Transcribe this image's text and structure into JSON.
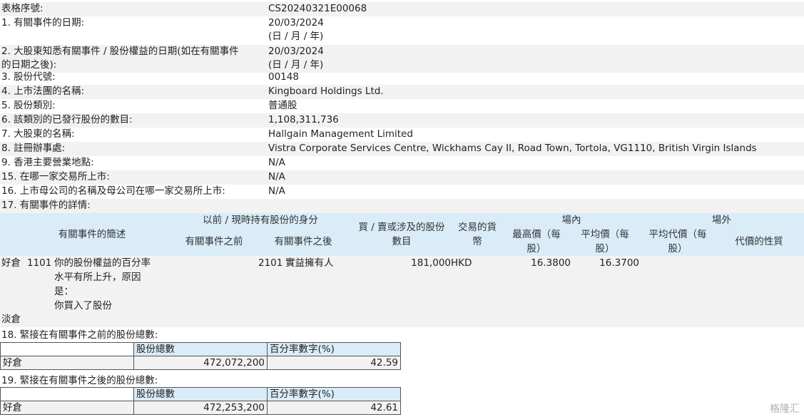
{
  "form_serial": {
    "label": "表格序號:",
    "value": "CS20240321E00068"
  },
  "fields": [
    {
      "label": [
        "1. 有關事件的日期:"
      ],
      "value": [
        "20/03/2024",
        "(日 / 月 / 年)"
      ]
    },
    {
      "label": [
        "2. 大股東知悉有關事件 / 股份權益的日期(如在有關事件",
        "的日期之後):"
      ],
      "value": [
        "20/03/2024",
        "(日 / 月 / 年)"
      ]
    },
    {
      "label": [
        "3. 股份代號:"
      ],
      "value": [
        "00148"
      ]
    },
    {
      "label": [
        "4. 上市法團的名稱:"
      ],
      "value": [
        "Kingboard Holdings Ltd."
      ]
    },
    {
      "label": [
        "5. 股份類別:"
      ],
      "value": [
        "普通股"
      ]
    },
    {
      "label": [
        "6. 該類別的已發行股份的數目:"
      ],
      "value": [
        "1,108,311,736"
      ]
    },
    {
      "label": [
        "7. 大股東的名稱:"
      ],
      "value": [
        "Hallgain Management Limited"
      ]
    },
    {
      "label": [
        "8. 註冊辦事處:"
      ],
      "value": [
        "Vistra Corporate Services Centre, Wickhams Cay II, Road Town, Tortola, VG1110, British Virgin Islands"
      ]
    },
    {
      "label": [
        "9. 香港主要營業地點:"
      ],
      "value": [
        "N/A"
      ]
    },
    {
      "label": [
        "15. 在哪一家交易所上市:"
      ],
      "value": [
        "N/A"
      ]
    },
    {
      "label": [
        "16. 上市母公司的名稱及母公司在哪一家交易所上市:"
      ],
      "value": [
        "N/A"
      ]
    }
  ],
  "section17": {
    "title": "17. 有關事件的詳情:",
    "headers": {
      "brief": "有關事件的簡述",
      "capacity": "以前 / 現時持有股份的身分",
      "before": "有關事件之前",
      "after": "有關事件之後",
      "shares": [
        "買 / 賣或涉及的股份",
        "數目"
      ],
      "currency": [
        "交易的貨",
        "幣"
      ],
      "onexchange": "場內",
      "high": [
        "最高價（每",
        "股）"
      ],
      "avg": [
        "平均價（每",
        "股）"
      ],
      "offexchange": "場外",
      "off_avg": [
        "平均代價（每",
        "股）"
      ],
      "consideration": "代價的性質"
    },
    "row": {
      "position": "好倉",
      "code_before": "1101",
      "brief": [
        "你的股份權益的百分率",
        "水平有所上升，原因",
        "是：",
        "你買入了股份"
      ],
      "code_after": "2101",
      "capacity_after": "實益擁有人",
      "shares": "181,000",
      "currency": "HKD",
      "high": "16.3800",
      "avg": "16.3700"
    },
    "short_label": "淡倉"
  },
  "section18": {
    "title": "18. 緊接在有關事件之前的股份總數:",
    "col_total": "股份總數",
    "col_pct": "百分率數字(%)",
    "row_label": "好倉",
    "total": "472,072,200",
    "pct": "42.59"
  },
  "section19": {
    "title": "19. 緊接在有關事件之後的股份總數:",
    "col_total": "股份總數",
    "col_pct": "百分率數字(%)",
    "row_label": "好倉",
    "total": "472,253,200",
    "pct": "42.61"
  },
  "watermark": "格隆汇"
}
